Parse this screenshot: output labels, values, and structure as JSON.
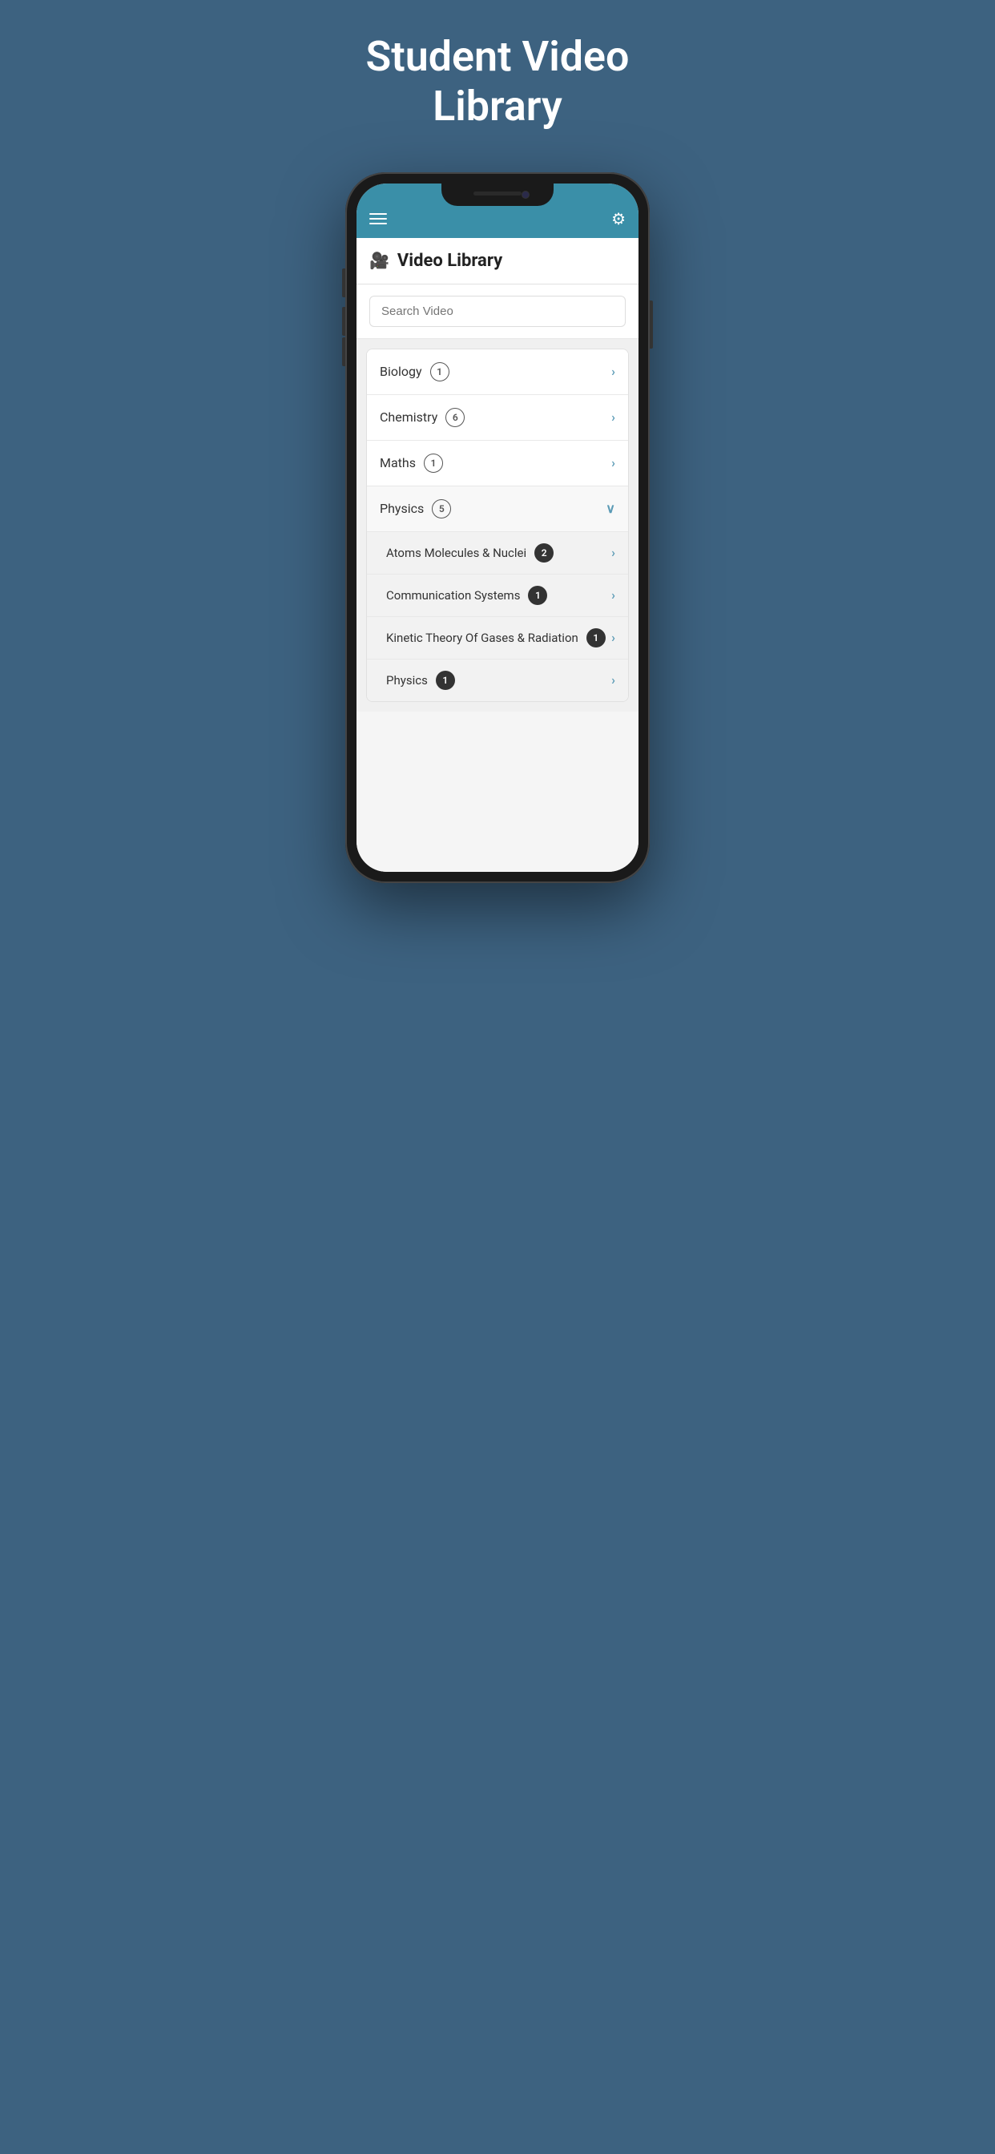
{
  "page": {
    "background_title_line1": "Student Video",
    "background_title_line2": "Library"
  },
  "header": {
    "menu_icon": "≡",
    "settings_icon": "⚙"
  },
  "app": {
    "title": "Video Library",
    "camera_icon": "🎥"
  },
  "search": {
    "placeholder": "Search Video"
  },
  "subjects": [
    {
      "id": "biology",
      "label": "Biology",
      "count": "1",
      "badge_type": "outline",
      "expanded": false
    },
    {
      "id": "chemistry",
      "label": "Chemistry",
      "count": "6",
      "badge_type": "outline",
      "expanded": false
    },
    {
      "id": "maths",
      "label": "Maths",
      "count": "1",
      "badge_type": "outline",
      "expanded": false
    },
    {
      "id": "physics",
      "label": "Physics",
      "count": "5",
      "badge_type": "outline",
      "expanded": true
    }
  ],
  "physics_sub": [
    {
      "id": "atoms",
      "label": "Atoms Molecules & Nuclei",
      "count": "2",
      "badge_type": "dark"
    },
    {
      "id": "communication",
      "label": "Communication Systems",
      "count": "1",
      "badge_type": "dark"
    },
    {
      "id": "kinetic",
      "label": "Kinetic Theory Of Gases & Radiation",
      "count": "1",
      "badge_type": "dark"
    },
    {
      "id": "physics-sub",
      "label": "Physics",
      "count": "1",
      "badge_type": "dark"
    }
  ],
  "colors": {
    "header_bg": "#3a8fa8",
    "background": "#3d6280",
    "accent": "#5a9ab5"
  }
}
